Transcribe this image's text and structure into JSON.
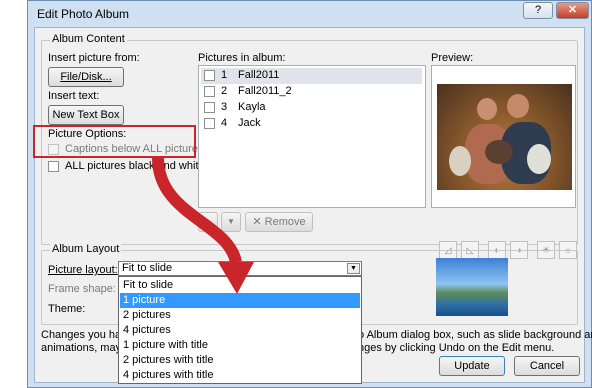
{
  "dialog": {
    "title": "Edit Photo Album",
    "help_label": "?",
    "close_label": "✕"
  },
  "album_content": {
    "legend": "Album Content",
    "insert_picture_label": "Insert picture from:",
    "file_disk_button": "File/Disk...",
    "insert_text_label": "Insert text:",
    "new_text_box_button": "New Text Box",
    "picture_options_label": "Picture Options:",
    "captions_label": "Captions below ALL pictures",
    "bw_label": "ALL pictures black and white",
    "pictures_in_album_label": "Pictures in album:",
    "pictures": [
      {
        "num": "1",
        "name": "Fall2011",
        "selected": true
      },
      {
        "num": "2",
        "name": "Fall2011_2",
        "selected": false
      },
      {
        "num": "3",
        "name": "Kayla",
        "selected": false
      },
      {
        "num": "4",
        "name": "Jack",
        "selected": false
      }
    ],
    "move_up_label": "▲",
    "move_down_label": "▼",
    "remove_label": "Remove",
    "preview_label": "Preview:"
  },
  "album_layout": {
    "legend": "Album Layout",
    "picture_layout_label": "Picture layout:",
    "picture_layout_value": "Fit to slide",
    "frame_shape_label": "Frame shape:",
    "theme_label": "Theme:",
    "layout_options": [
      {
        "label": "Fit to slide",
        "highlighted": false
      },
      {
        "label": "1 picture",
        "highlighted": true
      },
      {
        "label": "2 pictures",
        "highlighted": false
      },
      {
        "label": "4 pictures",
        "highlighted": false
      },
      {
        "label": "1 picture with title",
        "highlighted": false
      },
      {
        "label": "2 pictures with title",
        "highlighted": false
      },
      {
        "label": "4 pictures with title",
        "highlighted": false
      }
    ]
  },
  "footer": {
    "note_left_1": "Changes you have",
    "note_right_1": "o Album dialog box, such as slide background and",
    "note_left_2": "animations, may b",
    "note_right_2": "nges by clicking Undo on the Edit menu.",
    "update_button": "Update",
    "cancel_button": "Cancel"
  },
  "colors": {
    "highlight": "#3399ff",
    "callout": "#c9252b"
  }
}
